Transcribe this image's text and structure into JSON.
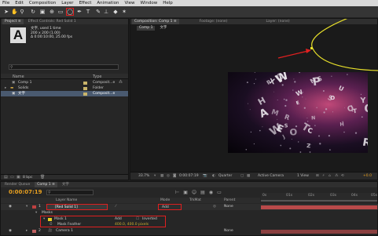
{
  "menu": [
    "File",
    "Edit",
    "Composition",
    "Layer",
    "Effect",
    "Animation",
    "View",
    "Window",
    "Help"
  ],
  "project": {
    "tabs": [
      "Project ≡",
      "Effect Controls: Red Solid 1"
    ],
    "selected_name": "文字",
    "used": ", used 1 time",
    "size": "200 x 200 (1.00)",
    "duration": "Δ 0:00:10:00, 25.00 fps",
    "search_placeholder": "",
    "columns": {
      "name": "Name",
      "type": "Type"
    },
    "items": [
      {
        "name": "Comp 1",
        "type": "Composit...e",
        "color": "#c9b46a",
        "icon": "comp-icon"
      },
      {
        "name": "Solids",
        "type": "Folder",
        "color": "#c9b46a",
        "icon": "folder-icon"
      },
      {
        "name": "文字",
        "type": "Composit...e",
        "color": "#c9b46a",
        "icon": "comp-icon"
      }
    ],
    "bpc": "8 bpc"
  },
  "viewer": {
    "tabs": [
      "Composition: Comp 1 ≡",
      "Footage: (none)",
      "Layer: (none)"
    ],
    "breadcrumb": [
      "Comp 1",
      "文字"
    ],
    "zoom": "33.7%",
    "timecode": "0:00:07:19",
    "resolution": "Quarter",
    "camera": "Active Camera",
    "views": "1 View",
    "exposure": "+0.0",
    "letters": [
      "N",
      "P",
      "O",
      "S",
      "W",
      "Z",
      "O",
      "R",
      "E",
      "T",
      "H",
      "X",
      "Y",
      "Q",
      "U",
      "R",
      "S",
      "T",
      "H",
      "O",
      "W",
      "E",
      "J",
      "A",
      "N",
      "W",
      "O",
      "M",
      "C",
      "S",
      "R"
    ]
  },
  "timeline": {
    "tabs": [
      "Render Queue",
      "Comp 1 ≡",
      "文字"
    ],
    "timecode": "0:00:07:19",
    "search_placeholder": "",
    "columns": {
      "layer_name": "Layer Name",
      "mode": "Mode",
      "trkmat": "TrkMat",
      "parent": "Parent"
    },
    "ruler": [
      "0s",
      "01s",
      "02s",
      "03s",
      "04s",
      "05s"
    ],
    "layers": [
      {
        "num": "1",
        "name": "[Red Solid 1]",
        "color": "#c04040",
        "mode": "Add",
        "parent": "None"
      },
      {
        "num": "",
        "name": "Masks",
        "color": "",
        "mode": "",
        "parent": ""
      },
      {
        "num": "",
        "name": "Mask 1",
        "color": "#e8d020",
        "mode": "Add",
        "parent": "Inverted"
      },
      {
        "num": "",
        "name": "Mask Feather",
        "color": "",
        "mode": "400.0, 400.0 pixels",
        "parent": ""
      },
      {
        "num": "2",
        "name": "Camera 1",
        "color": "#c06060",
        "mode": "",
        "parent": "None"
      }
    ]
  },
  "colors": {
    "accent": "#e8e02a",
    "annotation": "#e02020",
    "timecode": "#e8a020"
  }
}
